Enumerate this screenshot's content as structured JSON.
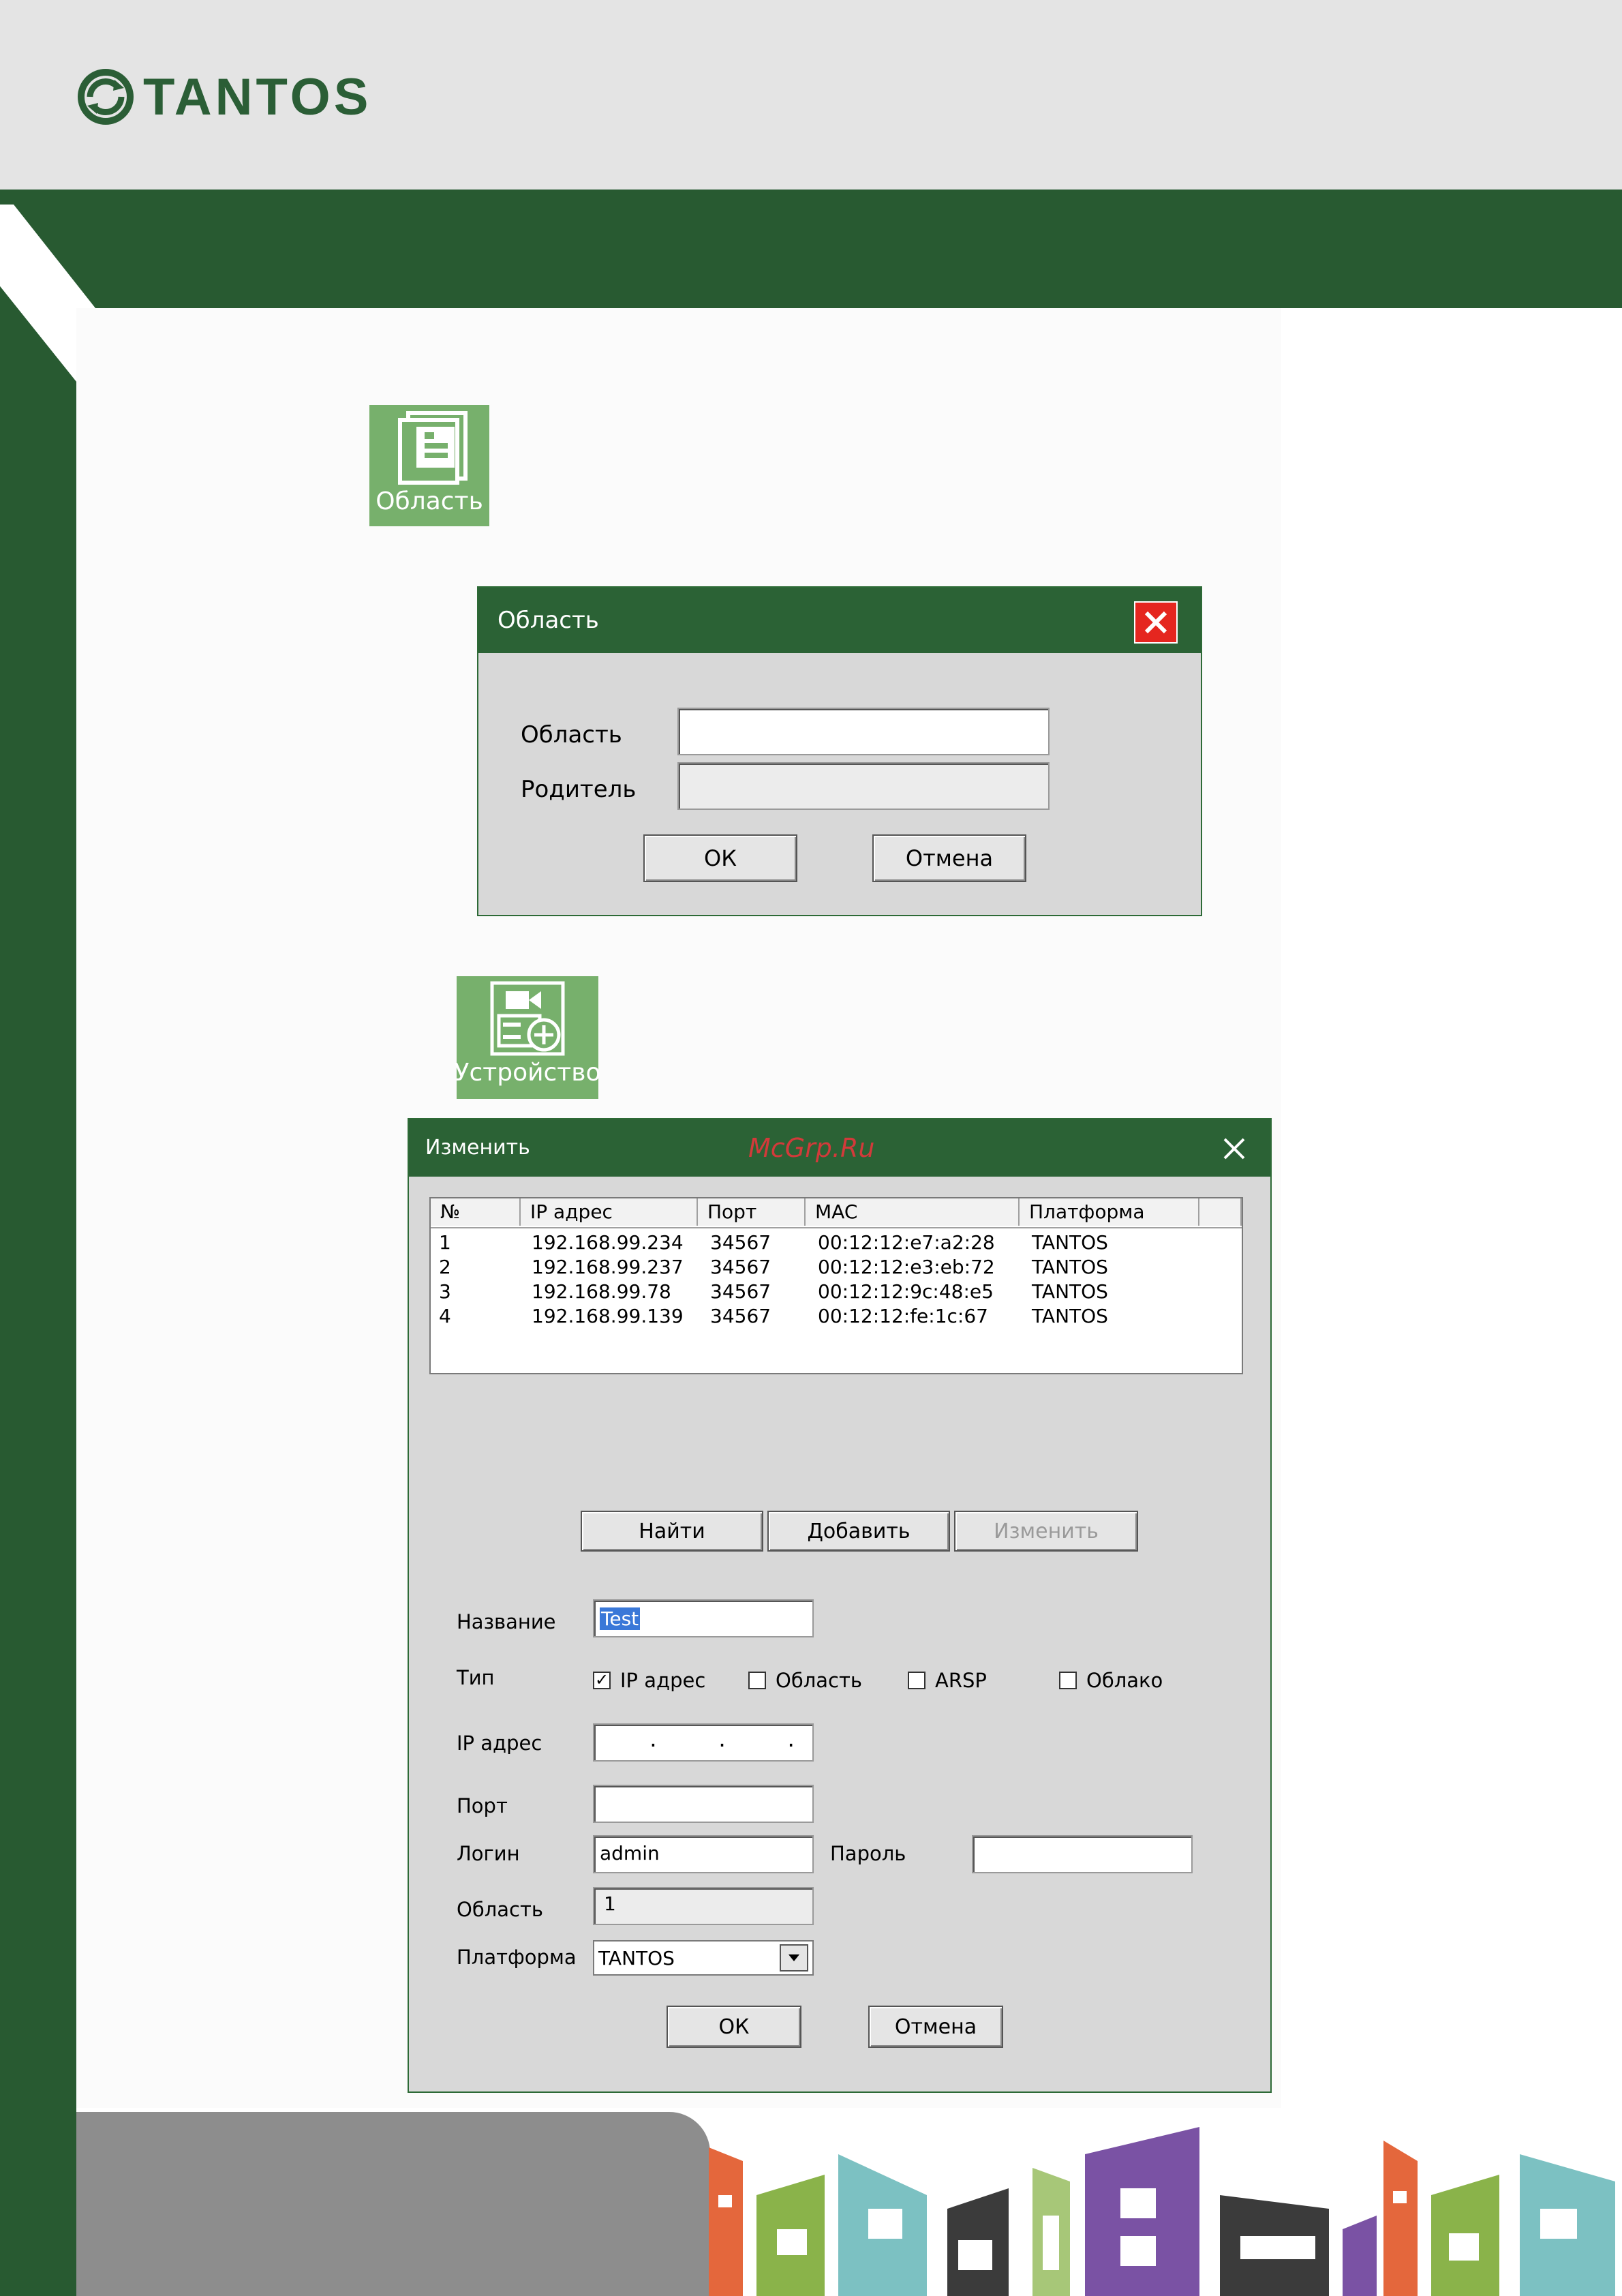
{
  "brand": {
    "name": "TANTOS"
  },
  "colors": {
    "brand_green": "#285a31",
    "tile_green": "#77b06c",
    "close_red": "#e5261f"
  },
  "tiles": {
    "area": {
      "label": "Область",
      "icon": "area-icon"
    },
    "device": {
      "label": "Устройство",
      "icon": "add-device-icon"
    }
  },
  "area_dialog": {
    "title": "Область",
    "area_label": "Область",
    "area_value": "",
    "parent_label": "Родитель",
    "parent_value": "",
    "ok": "ОК",
    "cancel": "Отмена"
  },
  "edit_dialog": {
    "title": "Изменить",
    "watermark": "McGrp.Ru",
    "table": {
      "columns": [
        "№",
        "IP адрес",
        "Порт",
        "MAC",
        "Платформа"
      ],
      "rows": [
        [
          "1",
          "192.168.99.234",
          "34567",
          "00:12:12:e7:a2:28",
          "TANTOS"
        ],
        [
          "2",
          "192.168.99.237",
          "34567",
          "00:12:12:e3:eb:72",
          "TANTOS"
        ],
        [
          "3",
          "192.168.99.78",
          "34567",
          "00:12:12:9c:48:e5",
          "TANTOS"
        ],
        [
          "4",
          "192.168.99.139",
          "34567",
          "00:12:12:fe:1c:67",
          "TANTOS"
        ]
      ]
    },
    "buttons": {
      "find": "Найти",
      "add": "Добавить",
      "edit": "Изменить"
    },
    "name_label": "Название",
    "name_value": "Test",
    "type_label": "Тип",
    "types": [
      {
        "label": "IP адрес",
        "checked": true
      },
      {
        "label": "Область",
        "checked": false
      },
      {
        "label": "ARSP",
        "checked": false
      },
      {
        "label": "Облако",
        "checked": false
      }
    ],
    "ip_label": "IP адрес",
    "ip_value": ".     .     .",
    "port_label": "Порт",
    "port_value": "",
    "login_label": "Логин",
    "login_value": "admin",
    "password_label": "Пароль",
    "password_value": "",
    "area_label": "Область",
    "area_value": "1",
    "platform_label": "Платформа",
    "platform_value": "TANTOS",
    "ok": "ОК",
    "cancel": "Отмена"
  }
}
